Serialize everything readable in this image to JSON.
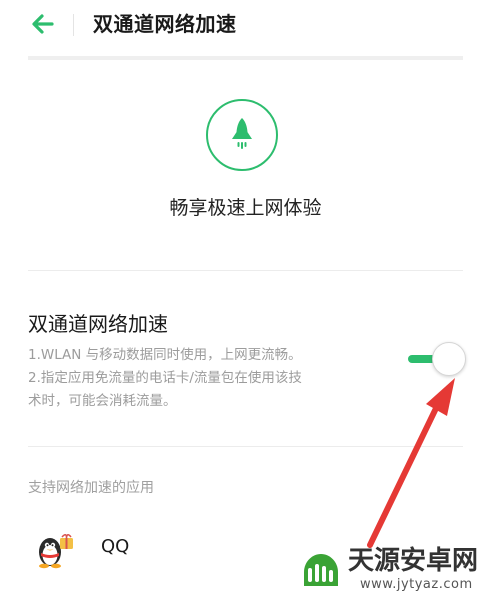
{
  "header": {
    "back_icon": "arrow-left-icon",
    "title": "双通道网络加速"
  },
  "hero": {
    "icon": "rocket-icon",
    "tagline": "畅享极速上网体验"
  },
  "setting": {
    "title": "双通道网络加速",
    "description_lines": [
      "1.WLAN 与移动数据同时使用，上网更流畅。",
      "2.指定应用免流量的电话卡/流量包在使用该技",
      "术时，可能会消耗流量。"
    ],
    "toggle_on": true
  },
  "apps_section": {
    "label": "支持网络加速的应用",
    "apps": [
      {
        "name": "QQ",
        "icon": "qq-penguin-icon"
      }
    ]
  },
  "watermark": {
    "title": "天源安卓网",
    "url": "www.jytyaz.com"
  },
  "colors": {
    "accent": "#2dbd6e",
    "annotation": "#e53935"
  }
}
